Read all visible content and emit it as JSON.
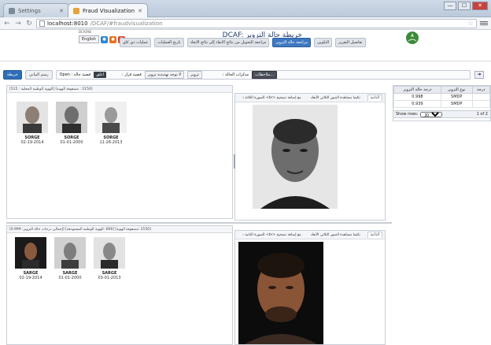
{
  "browser": {
    "tabs": [
      {
        "label": "Settings",
        "active": false
      },
      {
        "label": "Fraud Visualization",
        "active": true
      }
    ],
    "url_host": "localhost:8010",
    "url_path": "/DCAF/#fraudvisualization",
    "controls": [
      "—",
      "☐",
      "✕"
    ]
  },
  "header": {
    "title": "DCAF: خريطة حالة التزوير",
    "small_label": "DCAFAB",
    "lang_button": "English",
    "icons": [
      "chat-icon",
      "user-icon",
      "gplus-icon"
    ],
    "icon_colors": [
      "#2f86d6",
      "#e6731f",
      "#d6412f"
    ],
    "menu": [
      {
        "label": "تفاصيل التقرير",
        "active": false
      },
      {
        "label": "التكوين",
        "active": false
      },
      {
        "label": "مراجعة حالة التزوير",
        "active": true
      },
      {
        "label": "مراجعة التحويل من نتائج الابعاد إلى نتائج الابعاد",
        "active": false
      },
      {
        "label": "تاريخ العمليات",
        "active": false
      },
      {
        "label": "عمليات ذي كاي",
        "active": false
      }
    ]
  },
  "filterbar": {
    "map_button": "خريطة",
    "chart_button": "رسم البياني",
    "open_label": "Open : قضية حالة",
    "lock_button": "اغلق",
    "decision_label": ": قضية قرار",
    "no_threat": "لا توجد تهديدية تزوير",
    "fraud": "تزوير",
    "notes_label": ": مذكرات الحالة",
    "notes_button": "ملاحظات..."
  },
  "top_pane": {
    "header": "[515 : الهوية الوطنية المحلية] [2150 : مصفوفة الهوية]",
    "tabstrip": [
      "الذاتية",
      "تكشا مشاهدة الصور الثلاثي الأبعاد",
      "مع إضافة تصحيح <br> الصورة الثلاثة ›"
    ],
    "gallery": [
      {
        "name": "SORGE",
        "date": "02-19-2014"
      },
      {
        "name": "SORGE",
        "date": "01-01-2000"
      },
      {
        "name": "SORGE",
        "date": "11-26-2013"
      }
    ]
  },
  "bottom_pane": {
    "header": "[0.999 :إجمالي درجات حالة التزوير] [666 :الهوية الوطنية المستهدفة] [2150 :مصفوفة الهوية]",
    "tabstrip": [
      "الذاتية",
      "تكشا مشاهدة الصور الثلاثي الأبعاد",
      "مع إضافة تصحيح <br> الصورة الثانية ›"
    ],
    "gallery": [
      {
        "name": "SARGE",
        "date": "02-19-2014"
      },
      {
        "name": "SARGE",
        "date": "01-01-2000"
      },
      {
        "name": "SARGE",
        "date": "03-01-2013"
      }
    ]
  },
  "grid": {
    "columns": [
      "درجة حالة التزوير",
      "نوع التزوير",
      "درجة"
    ],
    "rows": [
      {
        "score": "0.998",
        "type": "SMDP"
      },
      {
        "score": "0.939",
        "type": "SMDP"
      }
    ],
    "show_rows_label": "Show rows:",
    "rows_value": "20",
    "page_info": "1 of 2"
  }
}
